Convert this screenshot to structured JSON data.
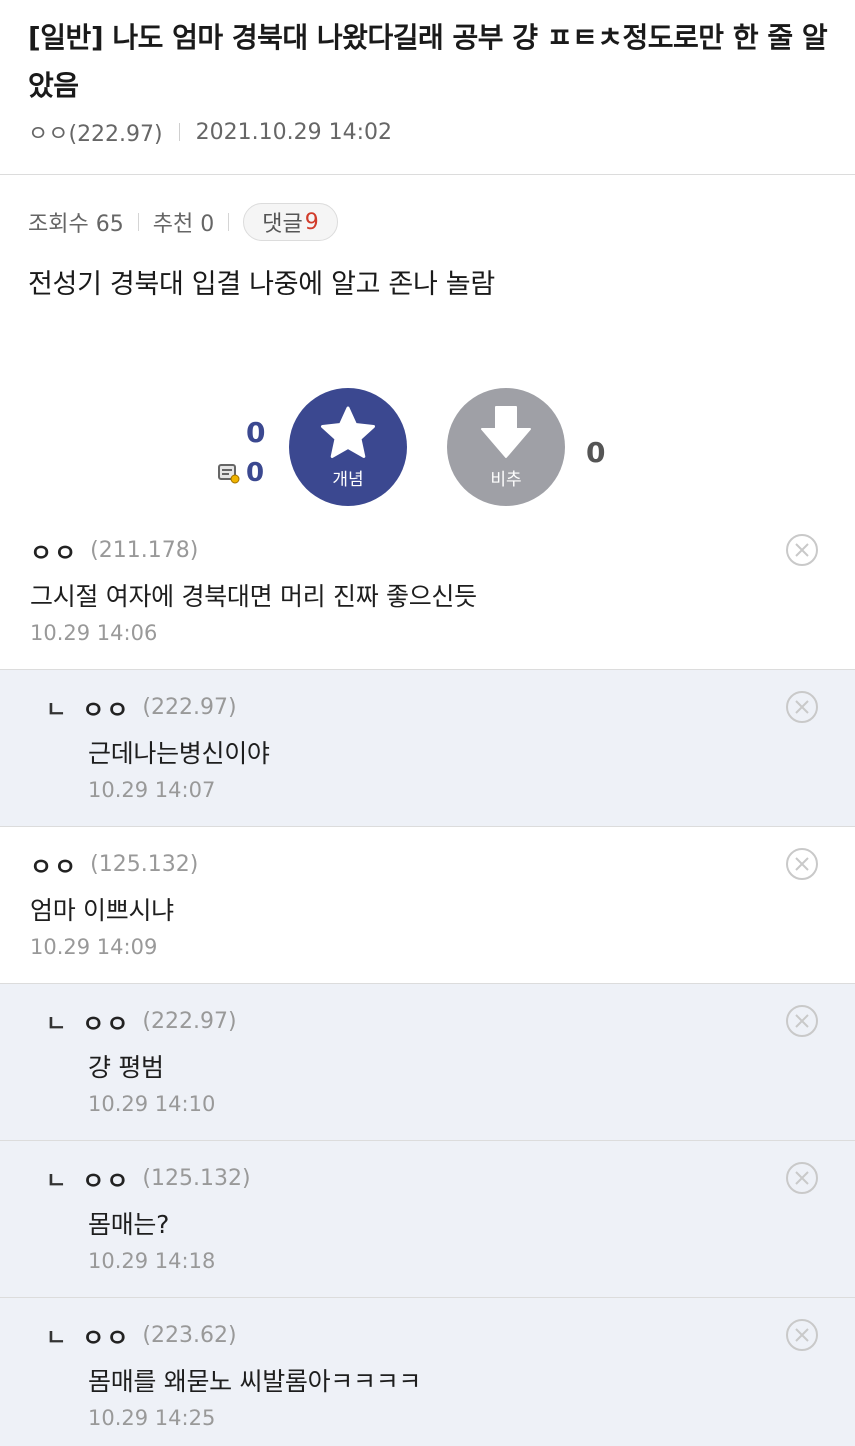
{
  "post": {
    "title": "[일반] 나도 엄마 경북대 나왔다길래 공부 걍 ㅍㅌㅊ정도로만 한 줄 알았음",
    "author": "ㅇㅇ(222.97)",
    "date": "2021.10.29 14:02",
    "views_label": "조회수 65",
    "recommend_label": "추천 0",
    "comment_label": "댓글",
    "comment_count": "9",
    "body": "전성기 경북대 입결 나중에 알고 존나 놀람"
  },
  "vote": {
    "up_count": "0",
    "fix_count": "0",
    "up_label": "개념",
    "down_label": "비추",
    "down_count": "0"
  },
  "comments": [
    {
      "reply": false,
      "nick": "ㅇㅇ",
      "ip": "(211.178)",
      "text": "그시절 여자에 경북대면 머리 진짜 좋으신듯",
      "date": "10.29 14:06"
    },
    {
      "reply": true,
      "nick": "ㅇㅇ",
      "ip": "(222.97)",
      "text": "근데나는병신이야",
      "date": "10.29 14:07"
    },
    {
      "reply": false,
      "nick": "ㅇㅇ",
      "ip": "(125.132)",
      "text": "엄마 이쁘시냐",
      "date": "10.29 14:09"
    },
    {
      "reply": true,
      "nick": "ㅇㅇ",
      "ip": "(222.97)",
      "text": "걍 평범",
      "date": "10.29 14:10"
    },
    {
      "reply": true,
      "nick": "ㅇㅇ",
      "ip": "(125.132)",
      "text": "몸매는?",
      "date": "10.29 14:18"
    },
    {
      "reply": true,
      "nick": "ㅇㅇ",
      "ip": "(223.62)",
      "text": "몸매를 왜묻노 씨발롬아ㅋㅋㅋㅋ",
      "date": "10.29 14:25"
    }
  ],
  "reply_mark": "ㄴ",
  "colors": {
    "accent": "#3b4890",
    "down": "#9fa0a6",
    "reply_bg": "#eef1f7",
    "comment_count": "#d13b2a"
  }
}
